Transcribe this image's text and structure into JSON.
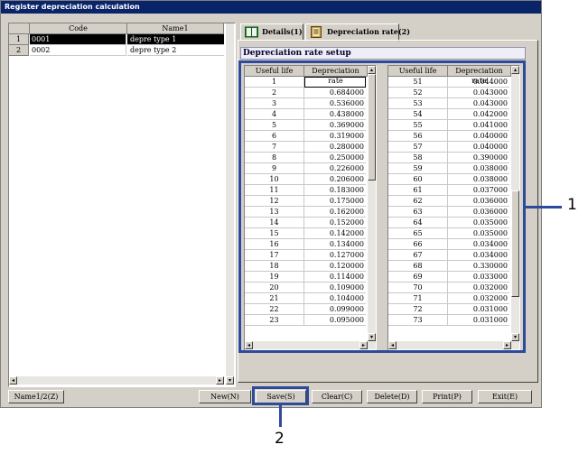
{
  "window": {
    "title": "Register depreciation calculation"
  },
  "left_list": {
    "columns": [
      "Code",
      "Name1"
    ],
    "rows": [
      {
        "num": "1",
        "code": "0001",
        "name": "depre type 1",
        "selected": true
      },
      {
        "num": "2",
        "code": "0002",
        "name": "depre type 2",
        "selected": false
      }
    ]
  },
  "tabs": [
    {
      "label": "Details(1)",
      "icon": "book-icon",
      "active": false
    },
    {
      "label": "Depreciation rate(2)",
      "icon": "ledger-icon",
      "active": true
    }
  ],
  "section": {
    "title": "Depreciation rate setup"
  },
  "rate_grid_left": {
    "columns": [
      "Useful life",
      "Depreciation rate"
    ],
    "rows": [
      [
        "1",
        ""
      ],
      [
        "2",
        "0.684000"
      ],
      [
        "3",
        "0.536000"
      ],
      [
        "4",
        "0.438000"
      ],
      [
        "5",
        "0.369000"
      ],
      [
        "6",
        "0.319000"
      ],
      [
        "7",
        "0.280000"
      ],
      [
        "8",
        "0.250000"
      ],
      [
        "9",
        "0.226000"
      ],
      [
        "10",
        "0.206000"
      ],
      [
        "11",
        "0.183000"
      ],
      [
        "12",
        "0.175000"
      ],
      [
        "13",
        "0.162000"
      ],
      [
        "14",
        "0.152000"
      ],
      [
        "15",
        "0.142000"
      ],
      [
        "16",
        "0.134000"
      ],
      [
        "17",
        "0.127000"
      ],
      [
        "18",
        "0.120000"
      ],
      [
        "19",
        "0.114000"
      ],
      [
        "20",
        "0.109000"
      ],
      [
        "21",
        "0.104000"
      ],
      [
        "22",
        "0.099000"
      ],
      [
        "23",
        "0.095000"
      ]
    ]
  },
  "rate_grid_right": {
    "columns": [
      "Useful life",
      "Depreciation rate"
    ],
    "rows": [
      [
        "51",
        "0.044000"
      ],
      [
        "52",
        "0.043000"
      ],
      [
        "53",
        "0.043000"
      ],
      [
        "54",
        "0.042000"
      ],
      [
        "55",
        "0.041000"
      ],
      [
        "56",
        "0.040000"
      ],
      [
        "57",
        "0.040000"
      ],
      [
        "58",
        "0.390000"
      ],
      [
        "59",
        "0.038000"
      ],
      [
        "60",
        "0.038000"
      ],
      [
        "61",
        "0.037000"
      ],
      [
        "62",
        "0.036000"
      ],
      [
        "63",
        "0.036000"
      ],
      [
        "64",
        "0.035000"
      ],
      [
        "65",
        "0.035000"
      ],
      [
        "66",
        "0.034000"
      ],
      [
        "67",
        "0.034000"
      ],
      [
        "68",
        "0.330000"
      ],
      [
        "69",
        "0.033000"
      ],
      [
        "70",
        "0.032000"
      ],
      [
        "71",
        "0.032000"
      ],
      [
        "72",
        "0.031000"
      ],
      [
        "73",
        "0.031000"
      ]
    ]
  },
  "buttons": {
    "name_toggle": "Name1/2(Z)",
    "new": "New(N)",
    "save": "Save(S)",
    "clear": "Clear(C)",
    "delete": "Delete(D)",
    "print": "Print(P)",
    "exit": "Exit(E)"
  },
  "callouts": {
    "grid": "1",
    "save": "2"
  },
  "colors": {
    "callout": "#2e4a9c",
    "title_bar": "#0a246a",
    "face": "#d4d0c8"
  }
}
